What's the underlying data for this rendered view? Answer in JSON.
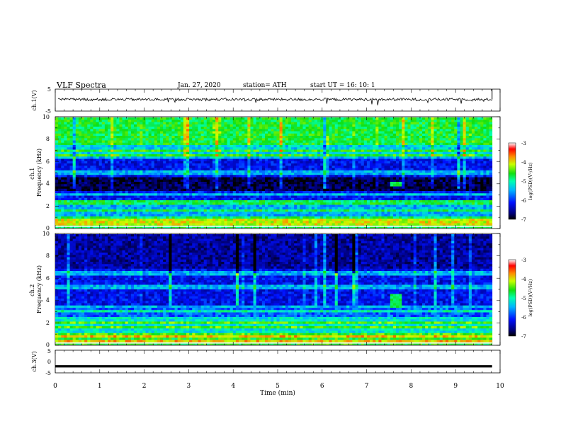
{
  "header": {
    "title": "VLF  Spectra",
    "date": "Jan. 27, 2020",
    "station": "station= ATH",
    "start": "start  UT  =    16: 10: 1"
  },
  "chart_data": [
    {
      "type": "line",
      "name": "ch1-waveform",
      "ylabel": "ch.1(V)",
      "ylim": [
        -5,
        5
      ],
      "yticks": [
        "5",
        "-5"
      ],
      "x_range_min": [
        0,
        9.82
      ],
      "baseline_v": 0.3,
      "noise_amplitude_v": 0.6
    },
    {
      "type": "heatmap",
      "name": "ch1-spectrogram",
      "ylabel": "ch.1\nFrequency (kHz)",
      "ylim": [
        0,
        10
      ],
      "yticks": [
        "0",
        "2",
        "4",
        "6",
        "8",
        "10"
      ],
      "x_range_min": [
        0,
        9.82
      ],
      "color_scale": {
        "label": "log(PSD)(V²/Hz)",
        "range": [
          -7,
          -3
        ],
        "ticks": [
          "-3",
          "-4",
          "-5",
          "-6",
          "-7"
        ]
      },
      "bands_khz": [
        {
          "from": 0.0,
          "to": 1.0,
          "level": 0.55
        },
        {
          "from": 1.0,
          "to": 2.5,
          "level": 0.38
        },
        {
          "from": 2.5,
          "to": 3.3,
          "level": 0.22
        },
        {
          "from": 3.3,
          "to": 4.6,
          "level": 0.05
        },
        {
          "from": 4.6,
          "to": 6.4,
          "level": 0.2
        },
        {
          "from": 6.4,
          "to": 7.4,
          "level": 0.42
        },
        {
          "from": 7.4,
          "to": 10.0,
          "level": 0.58
        }
      ],
      "lines_khz": [
        0.25,
        0.6,
        1.5,
        2.2,
        2.35,
        3.0,
        4.9,
        5.1,
        6.5,
        7.0
      ],
      "burst": {
        "t_min": [
          7.55,
          7.8
        ],
        "f_khz": [
          3.7,
          4.2
        ]
      }
    },
    {
      "type": "heatmap",
      "name": "ch2-spectrogram",
      "ylabel": "ch.2\nFrequency (kHz)",
      "ylim": [
        0,
        10
      ],
      "yticks": [
        "0",
        "2",
        "4",
        "6",
        "8",
        "10"
      ],
      "x_range_min": [
        0,
        9.82
      ],
      "color_scale": {
        "label": "log(PSD)(V²/Hz)",
        "range": [
          -7,
          -3
        ],
        "ticks": [
          "-3",
          "-4",
          "-5",
          "-6",
          "-7"
        ]
      },
      "bands_khz": [
        {
          "from": 0.0,
          "to": 0.9,
          "level": 0.6
        },
        {
          "from": 0.9,
          "to": 2.6,
          "level": 0.45
        },
        {
          "from": 2.6,
          "to": 3.4,
          "level": 0.3
        },
        {
          "from": 3.4,
          "to": 6.8,
          "level": 0.2
        },
        {
          "from": 6.8,
          "to": 10.0,
          "level": 0.12
        }
      ],
      "lines_khz": [
        0.3,
        0.8,
        1.5,
        2.0,
        3.0,
        3.5,
        5.2,
        6.5
      ],
      "burst": {
        "t_min": [
          7.5,
          7.8
        ],
        "f_khz": [
          3.4,
          4.6
        ]
      }
    },
    {
      "type": "line",
      "name": "ch3-waveform",
      "ylabel": "ch.3(V)",
      "ylim": [
        -5,
        5
      ],
      "yticks": [
        "5",
        "0",
        "-5"
      ],
      "x_range_min": [
        0,
        9.82
      ],
      "value_v": -2.1
    }
  ],
  "xaxis": {
    "label": "Time  (min)",
    "lim": [
      0,
      10
    ],
    "ticks": [
      "0",
      "1",
      "2",
      "3",
      "4",
      "5",
      "6",
      "7",
      "8",
      "9",
      "10"
    ]
  }
}
